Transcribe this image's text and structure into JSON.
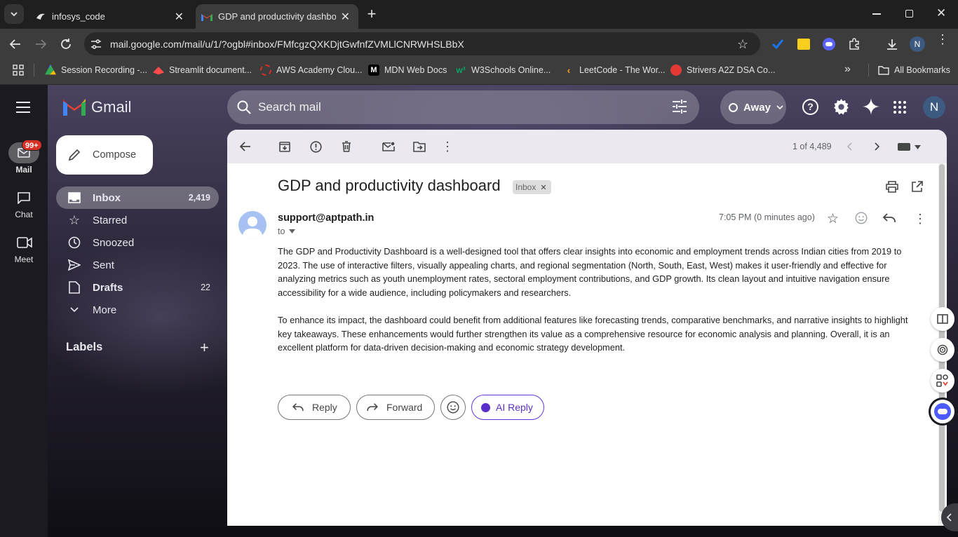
{
  "browser": {
    "tabs": [
      {
        "title": "infosys_code"
      },
      {
        "title": "GDP and productivity dashboard"
      }
    ],
    "url": "mail.google.com/mail/u/1/?ogbl#inbox/FMfcgzQXKDjtGwfnfZVMLlCNRWHSLBbX",
    "profile_initial": "N",
    "bookmarks": [
      {
        "label": "Session Recording -...",
        "color": "#34a853"
      },
      {
        "label": "Streamlit document...",
        "color": "#ff4b4b"
      },
      {
        "label": "AWS Academy Clou...",
        "color": "#d93025"
      },
      {
        "label": "MDN Web Docs",
        "color": "#000000"
      },
      {
        "label": "W3Schools Online...",
        "color": "#04aa6d"
      },
      {
        "label": "LeetCode - The Wor...",
        "color": "#ffa116"
      },
      {
        "label": "Strivers A2Z DSA Co...",
        "color": "#e53935"
      }
    ],
    "all_bookmarks": "All Bookmarks"
  },
  "gmail": {
    "logo": "Gmail",
    "rail": [
      {
        "label": "Mail",
        "badge": "99+"
      },
      {
        "label": "Chat"
      },
      {
        "label": "Meet"
      }
    ],
    "compose": "Compose",
    "nav": [
      {
        "label": "Inbox",
        "count": "2,419"
      },
      {
        "label": "Starred",
        "count": ""
      },
      {
        "label": "Snoozed",
        "count": ""
      },
      {
        "label": "Sent",
        "count": ""
      },
      {
        "label": "Drafts",
        "count": "22"
      },
      {
        "label": "More",
        "count": ""
      }
    ],
    "labels_heading": "Labels",
    "search_placeholder": "Search mail",
    "status": "Away",
    "avatar_initial": "N",
    "pagination": "1 of 4,489"
  },
  "email": {
    "subject": "GDP and productivity dashboard",
    "label_chip": "Inbox",
    "sender": "support@aptpath.in",
    "to": "to",
    "time": "7:05 PM (0 minutes ago)",
    "paragraph1": "The GDP and Productivity Dashboard is a well-designed tool that offers clear insights into economic and employment trends across Indian cities from 2019 to 2023. The use of interactive filters, visually appealing charts, and regional segmentation (North, South, East, West) makes it user-friendly and effective for analyzing metrics such as youth unemployment rates, sectoral employment contributions, and GDP growth. Its clean layout and intuitive navigation ensure accessibility for a wide audience, including policymakers and researchers.",
    "paragraph2": "To enhance its impact, the dashboard could benefit from additional features like forecasting trends, comparative benchmarks, and narrative insights to highlight key takeaways. These enhancements would further strengthen its value as a comprehensive resource for economic analysis and planning. Overall, it is an excellent platform for data-driven decision-making and economic strategy development.",
    "reply": "Reply",
    "forward": "Forward",
    "ai_reply": "AI Reply"
  }
}
